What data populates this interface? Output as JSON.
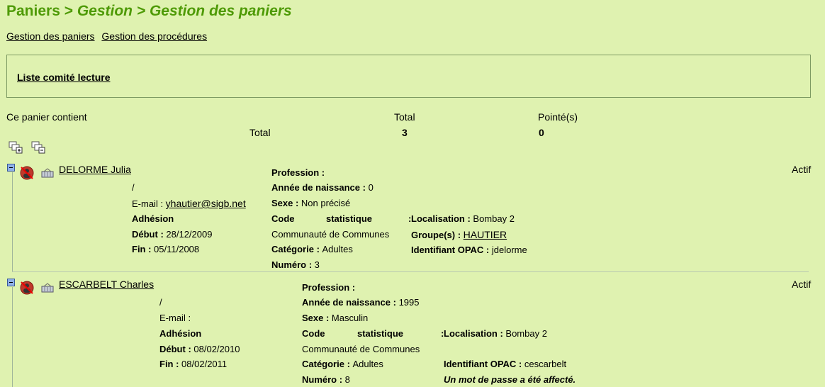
{
  "breadcrumb": {
    "part1": "Paniers > ",
    "part2": "Gestion",
    "sep": " > ",
    "part3": "Gestion des paniers"
  },
  "tabs": {
    "paniers": "Gestion des paniers",
    "procedures": "Gestion des procédures"
  },
  "basket": {
    "name": "Liste comité lecture"
  },
  "summary": {
    "contains_label": "Ce panier contient",
    "total_header": "Total",
    "pointed_header": "Pointé(s)",
    "row_label": "Total",
    "total_value": "3",
    "pointed_value": "0"
  },
  "icons": {
    "expand_all": "expand-all-icon",
    "collapse_all": "collapse-all-icon"
  },
  "readers": [
    {
      "name": "DELORME Julia",
      "status": "Actif",
      "address": "/",
      "email_label": "E-mail : ",
      "email": "yhautier@sigb.net",
      "adhesion_label": "Adhésion",
      "debut_label": "Début : ",
      "debut": "28/12/2009",
      "fin_label": "Fin : ",
      "fin": "05/11/2008",
      "profession_label": "Profession :",
      "annee_label": "Année de naissance : ",
      "annee": "0",
      "sexe_label": "Sexe : ",
      "sexe": "Non précisé",
      "code_label_1": "Code",
      "code_label_2": "statistique",
      "code_label_3": ":",
      "code_value": "Communauté de Communes",
      "categorie_label": "Catégorie : ",
      "categorie": "Adultes",
      "numero_label": "Numéro : ",
      "numero": "3",
      "localisation_label": "Localisation : ",
      "localisation": "Bombay 2",
      "groupe_label": "Groupe(s) : ",
      "groupe": "HAUTIER",
      "opac_label": "Identifiant OPAC : ",
      "opac": "jdelorme"
    },
    {
      "name": "ESCARBELT Charles",
      "status": "Actif",
      "address": "/",
      "email_label": "E-mail :",
      "adhesion_label": "Adhésion",
      "debut_label": "Début : ",
      "debut": "08/02/2010",
      "fin_label": "Fin : ",
      "fin": "08/02/2011",
      "profession_label": "Profession :",
      "annee_label": "Année de naissance : ",
      "annee": "1995",
      "sexe_label": "Sexe : ",
      "sexe": "Masculin",
      "code_label_1": "Code",
      "code_label_2": "statistique",
      "code_label_3": ":",
      "code_value": "Communauté de Communes",
      "categorie_label": "Catégorie : ",
      "categorie": "Adultes",
      "numero_label": "Numéro : ",
      "numero": "8",
      "localisation_label": "Localisation : ",
      "localisation": "Bombay 2",
      "opac_label": "Identifiant OPAC : ",
      "opac": "cescarbelt",
      "password_note": "Un mot de passe a été affecté."
    }
  ]
}
